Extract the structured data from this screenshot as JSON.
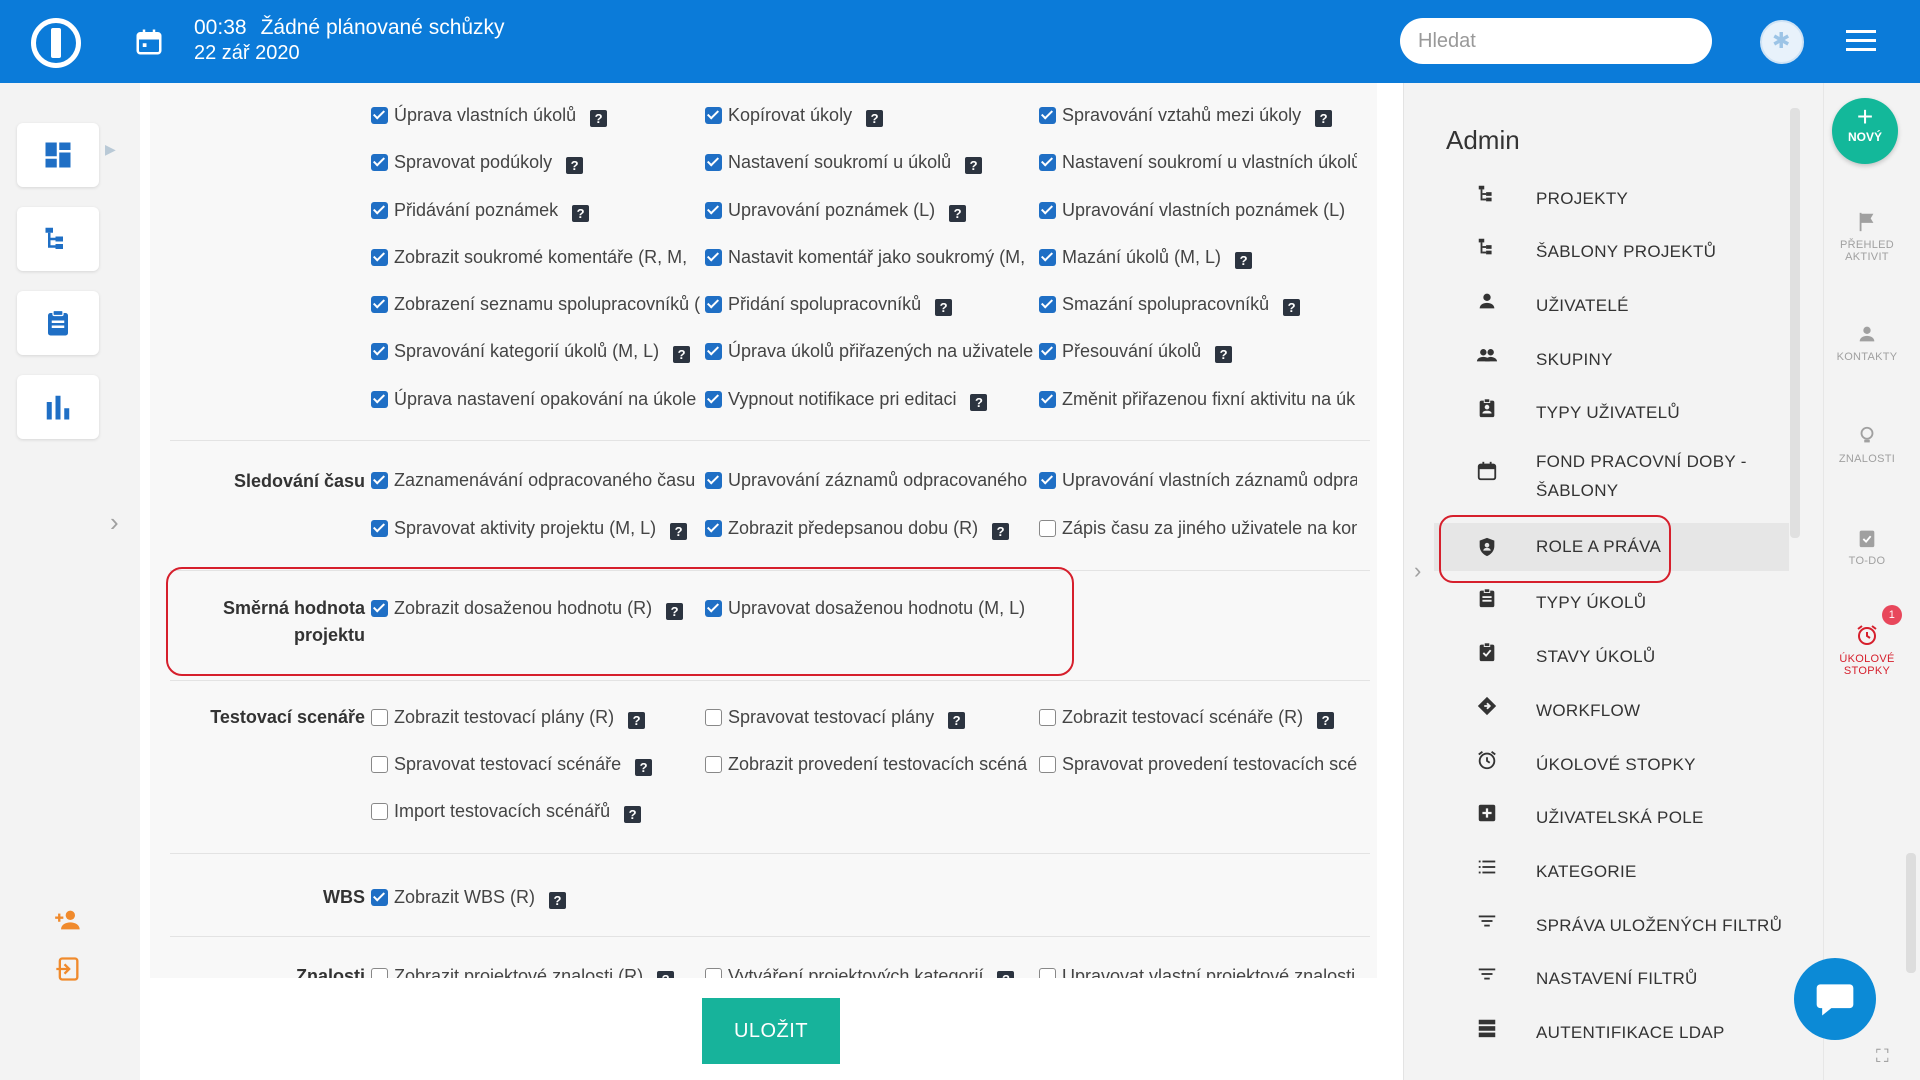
{
  "topbar": {
    "time": "00:38",
    "meeting_status": "Žádné plánované schůzky",
    "date": "22 zář 2020",
    "search_placeholder": "Hledat"
  },
  "sections": {
    "tasks": {
      "items": [
        {
          "label": "Úprava vlastních úkolů",
          "checked": true
        },
        {
          "label": "Kopírovat úkoly",
          "checked": true
        },
        {
          "label": "Spravování vztahů mezi úkoly",
          "checked": true
        },
        {
          "label": "Spravovat podúkoly",
          "checked": true
        },
        {
          "label": "Nastavení soukromí u úkolů",
          "checked": true
        },
        {
          "label": "Nastavení soukromí u vlastních úkolů",
          "checked": true
        },
        {
          "label": "Přidávání poznámek",
          "checked": true
        },
        {
          "label": "Upravování poznámek (L)",
          "checked": true
        },
        {
          "label": "Upravování vlastních poznámek (L)",
          "checked": true
        },
        {
          "label": "Zobrazit soukromé komentáře (R, M,",
          "checked": true
        },
        {
          "label": "Nastavit komentář jako soukromý (M,",
          "checked": true
        },
        {
          "label": "Mazání úkolů (M, L)",
          "checked": true
        },
        {
          "label": "Zobrazení seznamu spolupracovníků (",
          "checked": true
        },
        {
          "label": "Přidání spolupracovníků",
          "checked": true
        },
        {
          "label": "Smazání spolupracovníků",
          "checked": true
        },
        {
          "label": "Spravování kategorií úkolů (M, L)",
          "checked": true
        },
        {
          "label": "Úprava úkolů přiřazených na uživatele",
          "checked": true
        },
        {
          "label": "Přesouvání úkolů",
          "checked": true
        },
        {
          "label": "Úprava nastavení opakování na úkole",
          "checked": true
        },
        {
          "label": "Vypnout notifikace pri editaci",
          "checked": true
        },
        {
          "label": "Změnit přiřazenou fixní aktivitu na úk",
          "checked": true
        }
      ]
    },
    "time_tracking": {
      "label": "Sledování času",
      "items": [
        {
          "label": "Zaznamenávání odpracovaného času",
          "checked": true
        },
        {
          "label": "Upravování záznamů odpracovaného",
          "checked": true
        },
        {
          "label": "Upravování vlastních záznamů odprac",
          "checked": true
        },
        {
          "label": "Spravovat aktivity projektu (M, L)",
          "checked": true
        },
        {
          "label": "Zobrazit předepsanou dobu (R)",
          "checked": true
        },
        {
          "label": "Zápis času za jiného uživatele na konk",
          "checked": false
        }
      ]
    },
    "project_target": {
      "label_line1": "Směrná hodnota",
      "label_line2": "projektu",
      "items": [
        {
          "label": "Zobrazit dosaženou hodnotu (R)",
          "checked": true
        },
        {
          "label": "Upravovat dosaženou hodnotu (M, L)",
          "checked": true
        }
      ]
    },
    "test_scenarios": {
      "label": "Testovací scenáře",
      "items": [
        {
          "label": "Zobrazit testovací plány (R)",
          "checked": false
        },
        {
          "label": "Spravovat testovací plány",
          "checked": false
        },
        {
          "label": "Zobrazit testovací scénáře (R)",
          "checked": false
        },
        {
          "label": "Spravovat testovací scénáře",
          "checked": false
        },
        {
          "label": "Zobrazit provedení testovacích scéná",
          "checked": false
        },
        {
          "label": "Spravovat provedení testovacích scér",
          "checked": false
        },
        {
          "label": "Import testovacích scénářů",
          "checked": false
        }
      ]
    },
    "wbs": {
      "label": "WBS",
      "items": [
        {
          "label": "Zobrazit WBS (R)",
          "checked": true
        }
      ]
    },
    "knowledge": {
      "label": "Znalosti",
      "items": [
        {
          "label": "Zobrazit projektové znalosti (R)",
          "checked": false
        },
        {
          "label": "Vytváření projektových kategorií",
          "checked": false
        },
        {
          "label": "Upravovat vlastní projektové znalosti",
          "checked": false
        }
      ]
    }
  },
  "help_glyph": "?",
  "save_label": "ULOŽIT",
  "admin": {
    "title": "Admin",
    "items": [
      {
        "label": "PROJEKTY",
        "icon": "project-tree-icon"
      },
      {
        "label": "ŠABLONY PROJEKTŮ",
        "icon": "project-tree-icon"
      },
      {
        "label": "UŽIVATELÉ",
        "icon": "user-icon"
      },
      {
        "label": "SKUPINY",
        "icon": "group-icon"
      },
      {
        "label": "TYPY UŽIVATELŮ",
        "icon": "badge-icon"
      },
      {
        "label": "FOND PRACOVNÍ DOBY -",
        "label2": "ŠABLONY",
        "icon": "calendar-icon"
      },
      {
        "label": "ROLE A PRÁVA",
        "icon": "shield-icon"
      },
      {
        "label": "TYPY ÚKOLŮ",
        "icon": "clipboard-icon"
      },
      {
        "label": "STAVY ÚKOLŮ",
        "icon": "clipboard-check-icon"
      },
      {
        "label": "WORKFLOW",
        "icon": "workflow-icon"
      },
      {
        "label": "ÚKOLOVÉ STOPKY",
        "icon": "alarm-icon"
      },
      {
        "label": "UŽIVATELSKÁ POLE",
        "icon": "plus-box-icon"
      },
      {
        "label": "KATEGORIE",
        "icon": "list-icon"
      },
      {
        "label": "SPRÁVA ULOŽENÝCH FILTRŮ",
        "icon": "filter-icon"
      },
      {
        "label": "NASTAVENÍ FILTRŮ",
        "icon": "filter-icon"
      },
      {
        "label": "AUTENTIFIKACE LDAP",
        "icon": "server-icon"
      }
    ]
  },
  "rightrail": {
    "new_label": "NOVÝ",
    "activity_l1": "PŘEHLED",
    "activity_l2": "AKTIVIT",
    "contacts": "KONTAKTY",
    "knowledge": "ZNALOSTI",
    "todo": "TO-DO",
    "stopwatch_l1": "ÚKOLOVÉ",
    "stopwatch_l2": "STOPKY",
    "stopwatch_badge": "1"
  },
  "colors": {
    "topbar": "#0b7bd9",
    "checkbox": "#1f6fc5",
    "save": "#17b39b",
    "highlight": "#d61f2c"
  }
}
